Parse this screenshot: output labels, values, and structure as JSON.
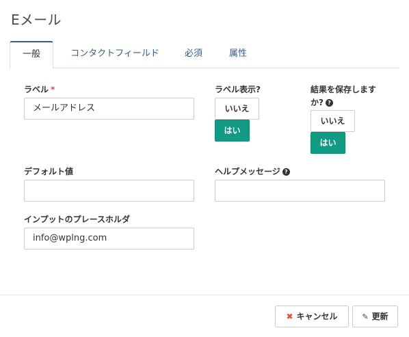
{
  "dialog": {
    "title": "Eメール"
  },
  "tabs": [
    {
      "label": "一般",
      "active": true
    },
    {
      "label": "コンタクトフィールド",
      "active": false
    },
    {
      "label": "必須",
      "active": false
    },
    {
      "label": "属性",
      "active": false
    }
  ],
  "form": {
    "label_field": {
      "label": "ラベル",
      "required_mark": "*",
      "value": "メールアドレス"
    },
    "show_label": {
      "label": "ラベル表示?",
      "no": "いいえ",
      "yes": "はい",
      "selected": "はい"
    },
    "save_result": {
      "label_line1": "結果を保存しま",
      "label_line1b": "す",
      "label_line2": "か?",
      "help": "?",
      "no": "いいえ",
      "yes": "はい",
      "selected": "はい"
    },
    "default_value": {
      "label": "デフォルト値",
      "value": ""
    },
    "help_message": {
      "label": "ヘルプメッセージ",
      "help": "?",
      "value": ""
    },
    "placeholder": {
      "label": "インプットのプレースホルダ",
      "value": "info@wplng.com"
    }
  },
  "footer": {
    "cancel_label": "キャンセル",
    "update_label": "更新"
  },
  "colors": {
    "accent_green": "#119a84",
    "tab_link": "#3a5a86",
    "required_red": "#e74c3c"
  },
  "icons": {
    "cancel": "close-icon",
    "update": "pencil-icon",
    "help": "question-circle-icon"
  }
}
